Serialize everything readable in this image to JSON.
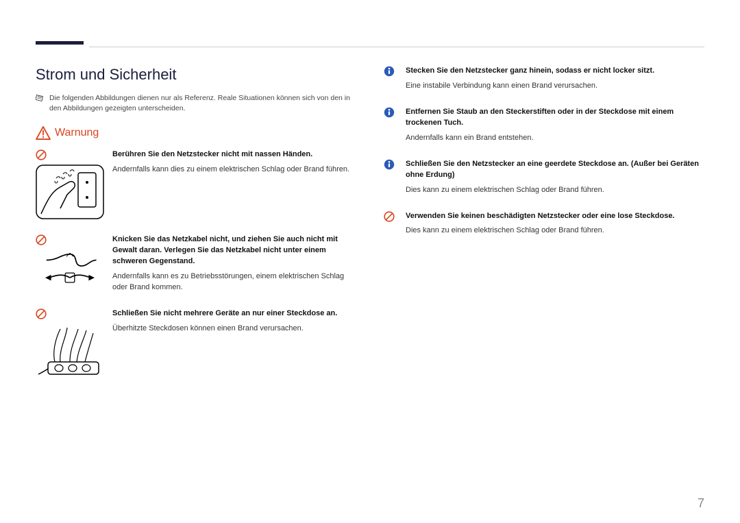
{
  "page_number": "7",
  "section_title": "Strom und Sicherheit",
  "reference_note": "Die folgenden Abbildungen dienen nur als Referenz. Reale Situationen können sich von den in den Abbildungen gezeigten unterscheiden.",
  "warning_label": "Warnung",
  "left_items": [
    {
      "bold": "Berühren Sie den Netzstecker nicht mit nassen Händen.",
      "body": "Andernfalls kann dies zu einem elektrischen Schlag oder Brand führen."
    },
    {
      "bold": "Knicken Sie das Netzkabel nicht, und ziehen Sie auch nicht mit Gewalt daran. Verlegen Sie das Netzkabel nicht unter einem schweren Gegenstand.",
      "body": "Andernfalls kann es zu Betriebsstörungen, einem elektrischen Schlag oder Brand kommen."
    },
    {
      "bold": "Schließen Sie nicht mehrere Geräte an nur einer Steckdose an.",
      "body": "Überhitzte Steckdosen können einen Brand verursachen."
    }
  ],
  "right_items": [
    {
      "icon": "info",
      "bold": "Stecken Sie den Netzstecker ganz hinein, sodass er nicht locker sitzt.",
      "body": "Eine instabile Verbindung kann einen Brand verursachen."
    },
    {
      "icon": "info",
      "bold": "Entfernen Sie Staub an den Steckerstiften oder in der Steckdose mit einem trockenen Tuch.",
      "body": "Andernfalls kann ein Brand entstehen."
    },
    {
      "icon": "info",
      "bold": "Schließen Sie den Netzstecker an eine geerdete Steckdose an. (Außer bei Geräten ohne Erdung)",
      "body": "Dies kann zu einem elektrischen Schlag oder Brand führen."
    },
    {
      "icon": "prohibit",
      "bold": "Verwenden Sie keinen beschädigten Netzstecker oder eine lose Steckdose.",
      "body": "Dies kann zu einem elektrischen Schlag oder Brand führen."
    }
  ]
}
